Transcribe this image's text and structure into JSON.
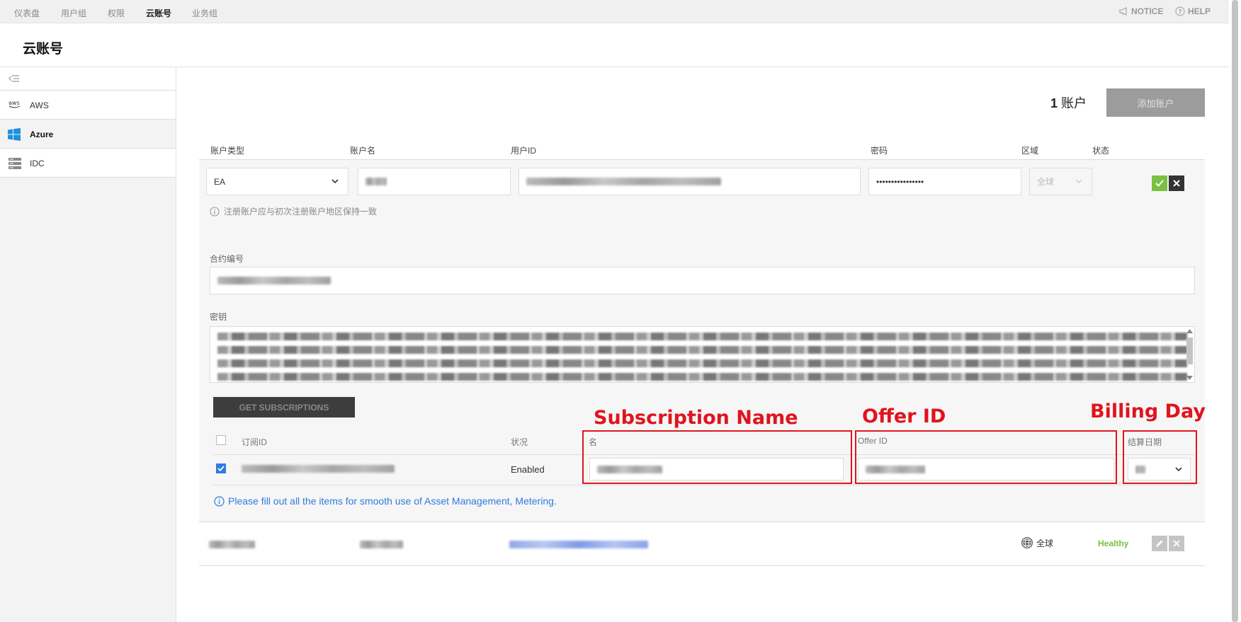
{
  "topnav": {
    "tabs": [
      {
        "label": "仪表盘",
        "active": false
      },
      {
        "label": "用户组",
        "active": false
      },
      {
        "label": "权限",
        "active": false
      },
      {
        "label": "云账号",
        "active": true
      },
      {
        "label": "业务组",
        "active": false
      }
    ],
    "notice_label": "NOTICE",
    "help_label": "HELP"
  },
  "page": {
    "title": "云账号"
  },
  "sidebar": {
    "items": [
      {
        "label": "AWS",
        "icon": "aws-icon",
        "active": false
      },
      {
        "label": "Azure",
        "icon": "windows-icon",
        "active": true
      },
      {
        "label": "IDC",
        "icon": "server-icon",
        "active": false
      }
    ]
  },
  "header": {
    "account_count": "1",
    "account_unit": "账户",
    "add_account_label": "添加账户"
  },
  "columns": {
    "account_type": "账户类型",
    "account_name": "账户名",
    "user_id": "用户ID",
    "password": "密码",
    "region": "区域",
    "status": "状态"
  },
  "edit_row": {
    "account_type_value": "EA",
    "password_value": "••••••••••••••••",
    "region_value": "全球",
    "hint": "注册账户应与初次注册账户地区保持一致",
    "contract_label": "合约编号",
    "key_label": "密钥",
    "get_subscriptions_label": "GET SUBSCRIPTIONS"
  },
  "subscriptions": {
    "headers": {
      "subscription_id": "订阅ID",
      "state": "状况",
      "name": "名",
      "offer_id": "Offer ID",
      "billing_day": "结算日期"
    },
    "rows": [
      {
        "checked": true,
        "state": "Enabled"
      }
    ]
  },
  "annotations": {
    "subscription_name": "Subscription Name",
    "offer_id": "Offer ID",
    "billing_day": "Billing Day"
  },
  "note": "Please fill out all the items for smooth use of Asset Management, Metering.",
  "account_row": {
    "region": "全球",
    "status": "Healthy"
  },
  "colors": {
    "accent": "#2f7bdd",
    "ok": "#7ac142",
    "annotation_red": "#e0141e"
  }
}
